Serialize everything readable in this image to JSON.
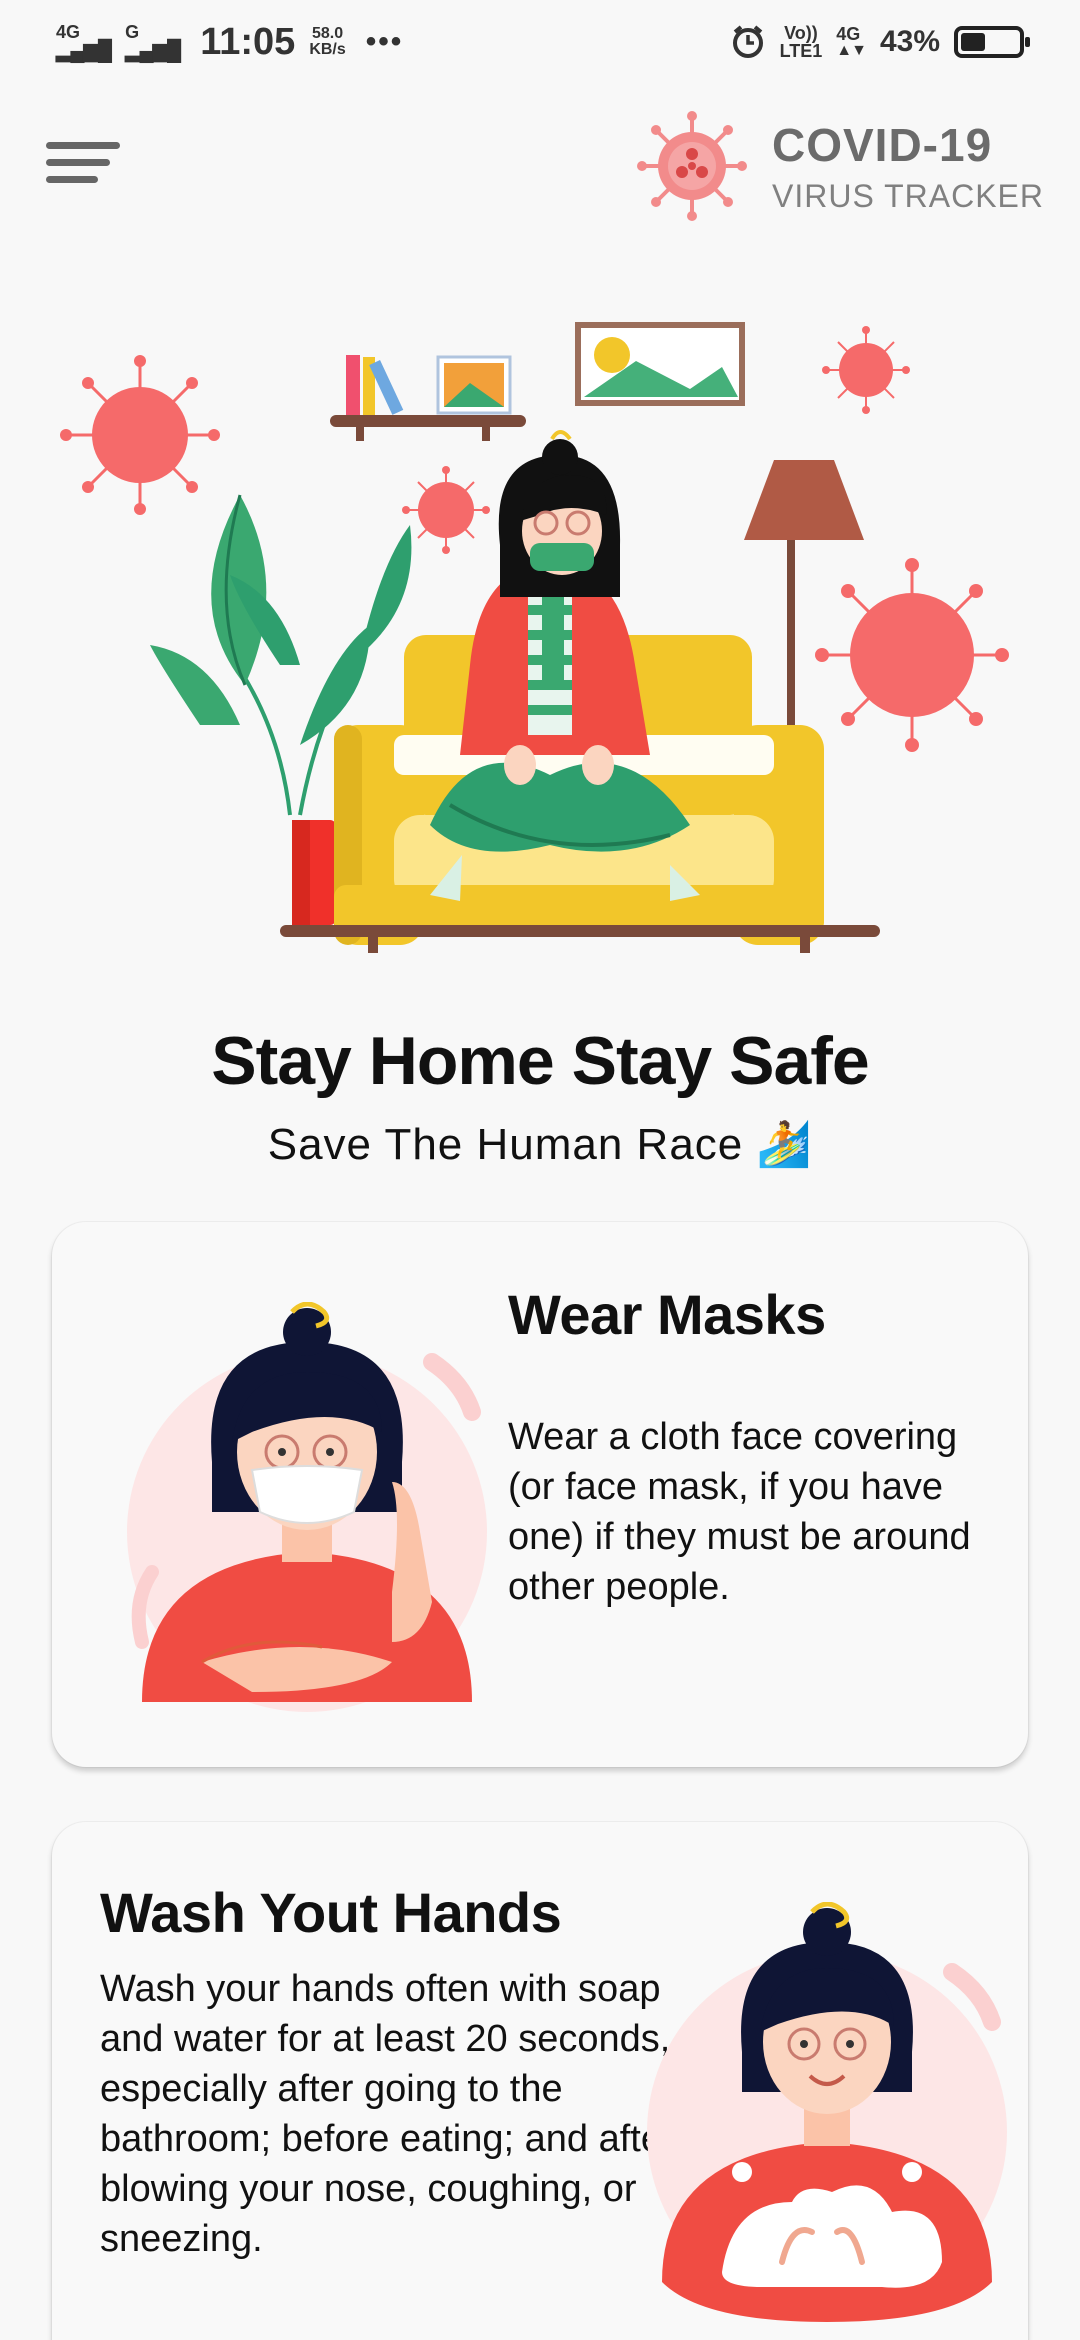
{
  "status_bar": {
    "net1": "4G",
    "net2": "G",
    "time": "11:05",
    "speed_value": "58.0",
    "speed_unit": "KB/s",
    "overflow": "•••",
    "volte": "Vo))",
    "lte": "LTE1",
    "net3": "4G",
    "battery_text": "43%",
    "battery_level": 0.43
  },
  "header": {
    "title": "COVID-19",
    "subtitle": "VIRUS TRACKER",
    "menu_icon": "hamburger-menu-icon",
    "logo_icon": "virus-logo-icon"
  },
  "hero": {
    "title": "Stay Home Stay Safe",
    "subtitle": "Save The Human Race 🏄",
    "illustration": "woman-on-sofa-illustration"
  },
  "cards": [
    {
      "title": "Wear Masks",
      "text": "Wear a cloth face covering (or face mask, if you have one) if they must be around other people.",
      "illustration": "woman-wearing-mask-illustration"
    },
    {
      "title": "Wash Yout Hands",
      "text": "Wash your hands often with soap and water for at least 20 seconds, especially after going to the bathroom; before eating; and after blowing your nose, coughing, or sneezing.",
      "illustration": "woman-washing-hands-illustration"
    }
  ],
  "colors": {
    "virus": "#f56a6a",
    "sofa": "#f2c62a",
    "plant": "#2e9f6e",
    "shirt": "#f04c43",
    "background": "#f8f8f8"
  }
}
